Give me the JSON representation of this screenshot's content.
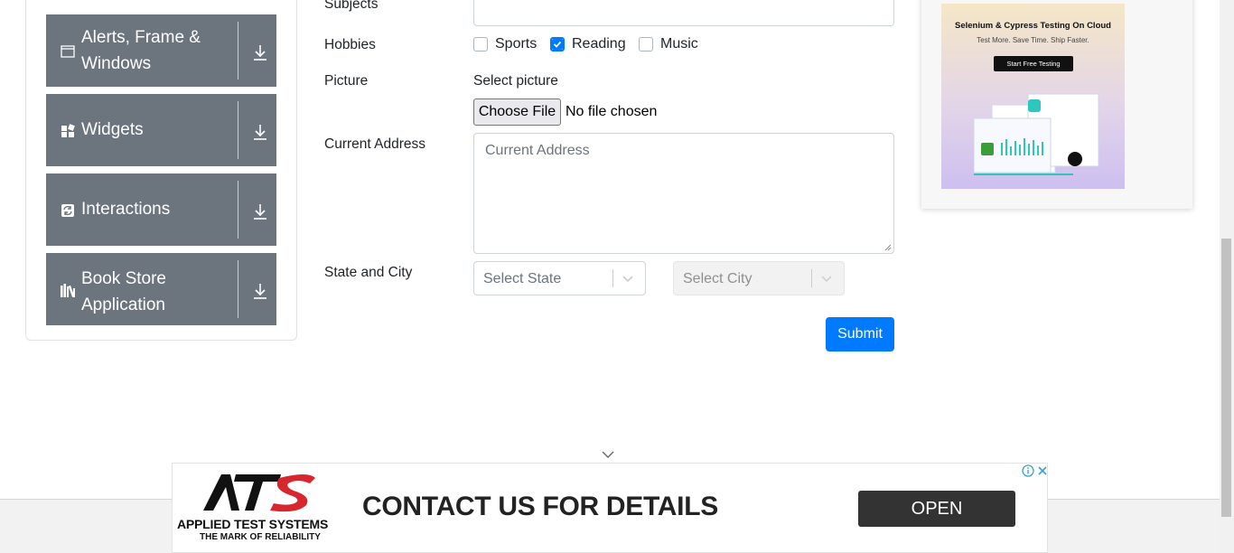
{
  "sidebar": {
    "groups": [
      {
        "label": "Alerts, Frame & Windows",
        "icon": "window-icon"
      },
      {
        "label": "Widgets",
        "icon": "widgets-icon"
      },
      {
        "label": "Interactions",
        "icon": "interactions-icon"
      },
      {
        "label": "Book Store Application",
        "icon": "books-icon"
      }
    ]
  },
  "form": {
    "subjects_label": "Subjects",
    "hobbies_label": "Hobbies",
    "hobbies": [
      {
        "label": "Sports",
        "checked": false
      },
      {
        "label": "Reading",
        "checked": true
      },
      {
        "label": "Music",
        "checked": false
      }
    ],
    "picture_label": "Picture",
    "picture_hint": "Select picture",
    "choose_file_label": "Choose File",
    "file_status": "No file chosen",
    "address_label": "Current Address",
    "address_placeholder": "Current Address",
    "state_city_label": "State and City",
    "state_placeholder": "Select State",
    "city_placeholder": "Select City",
    "submit_label": "Submit"
  },
  "side_ad": {
    "title": "Selenium & Cypress Testing On Cloud",
    "subtitle": "Test More. Save Time. Ship Faster.",
    "cta": "Start Free Testing"
  },
  "bottom_ad": {
    "brand": "APPLIED TEST SYSTEMS",
    "tagline": "THE MARK OF RELIABILITY",
    "headline": "CONTACT US FOR DETAILS",
    "cta": "OPEN"
  },
  "colors": {
    "group_bg": "#6c757d",
    "primary": "#007bff",
    "open_btn": "#333333"
  }
}
